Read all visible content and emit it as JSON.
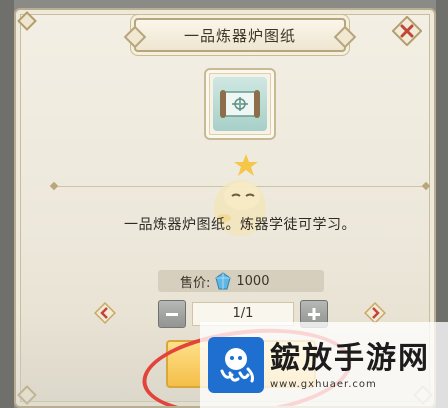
{
  "dialog": {
    "title": "一品炼器炉图纸",
    "item_icon": "blueprint-scroll-icon",
    "description": "一品炼器炉图纸。炼器学徒可学习。",
    "price": {
      "label": "售价:",
      "currency_icon": "blue-crystal-icon",
      "amount": "1000"
    },
    "quantity": {
      "value": "1/1",
      "minus_icon": "minus-icon",
      "plus_icon": "plus-icon"
    },
    "nav": {
      "prev_icon": "arrow-left-icon",
      "next_icon": "arrow-right-icon"
    },
    "buy_button_label": "",
    "close_icon": "close-icon"
  },
  "watermark": {
    "name": "鋐放手游网",
    "url": "www.gxhuaer.com"
  },
  "colors": {
    "panel_bg": "#ece7da",
    "frame": "#b9ad92",
    "buy_button": "#f4bf48",
    "highlight_ring": "#e2433b",
    "crystal": "#5fb7e6"
  }
}
